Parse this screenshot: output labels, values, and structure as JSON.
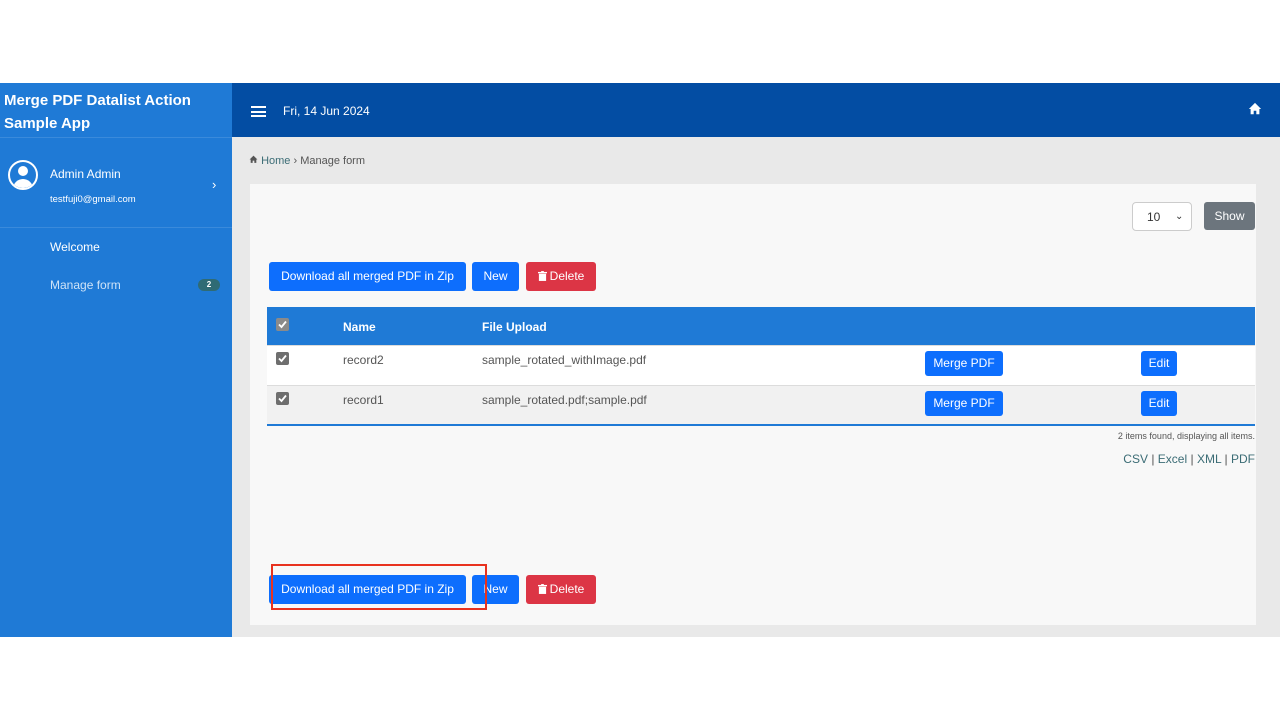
{
  "app": {
    "title": "Merge PDF Datalist Action Sample App"
  },
  "user": {
    "name": "Admin Admin",
    "email": "testfuji0@gmail.com"
  },
  "menu": {
    "welcome": "Welcome",
    "manage_form": "Manage form",
    "manage_form_badge": "2"
  },
  "header": {
    "date": "Fri, 14 Jun 2024"
  },
  "breadcrumb": {
    "home": "Home",
    "separator": "›",
    "current": "Manage form"
  },
  "pagination": {
    "page_size": "10",
    "show_label": "Show"
  },
  "actions": {
    "download_zip": "Download all merged PDF in Zip",
    "new": "New",
    "delete": "Delete"
  },
  "table": {
    "columns": [
      "Name",
      "File Upload"
    ],
    "rows": [
      {
        "name": "record2",
        "file": "sample_rotated_withImage.pdf",
        "merge_label": "Merge PDF",
        "edit_label": "Edit",
        "checked": true
      },
      {
        "name": "record1",
        "file": "sample_rotated.pdf;sample.pdf",
        "merge_label": "Merge PDF",
        "edit_label": "Edit",
        "checked": true
      }
    ],
    "summary": "2 items found, displaying all items."
  },
  "exports": {
    "csv": "CSV",
    "excel": "Excel",
    "xml": "XML",
    "pdf": "PDF",
    "separator": "|"
  },
  "colors": {
    "sidebar": "#1f7ad6",
    "header": "#034da3",
    "primary_button": "#0d6efd",
    "danger_button": "#dc3545",
    "secondary_button": "#6c757d",
    "highlight_box": "#e8321f"
  }
}
